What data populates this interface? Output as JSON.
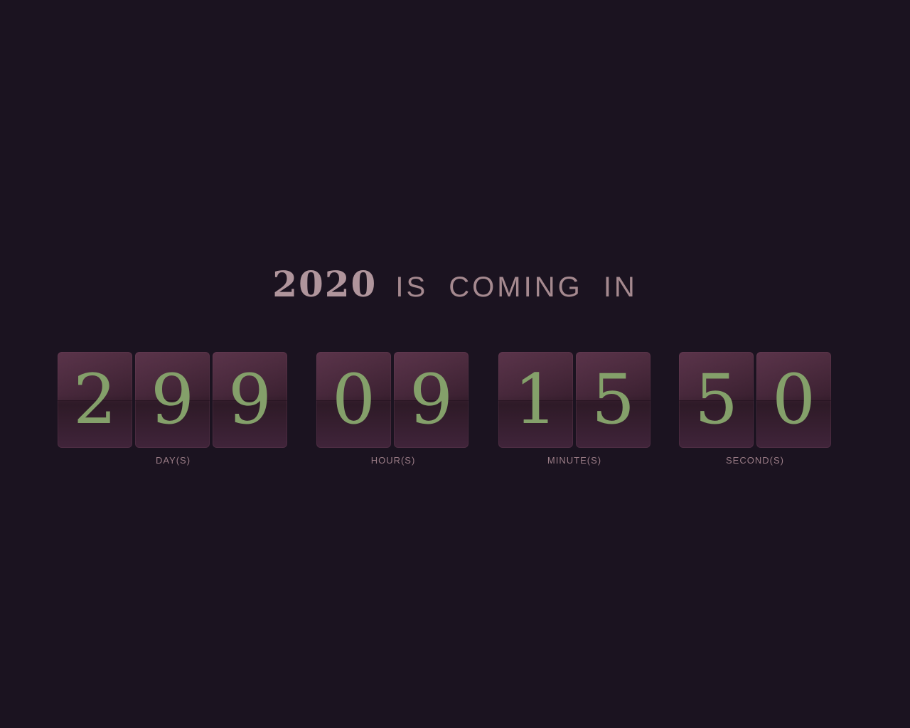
{
  "heading": {
    "year": "2020",
    "text": "IS COMING IN"
  },
  "countdown": {
    "days": {
      "digits": [
        "2",
        "9",
        "9"
      ],
      "label": "DAY(S)"
    },
    "hours": {
      "digits": [
        "0",
        "9"
      ],
      "label": "HOUR(S)"
    },
    "minutes": {
      "digits": [
        "1",
        "5"
      ],
      "label": "MINUTE(S)"
    },
    "seconds": {
      "digits": [
        "5",
        "0"
      ],
      "label": "SECOND(S)"
    }
  },
  "colors": {
    "background": "#1b1320",
    "heading": "#a5898f",
    "digit": "#84a06a",
    "tile": "#3a2030",
    "unit_label": "#9a7c86"
  }
}
